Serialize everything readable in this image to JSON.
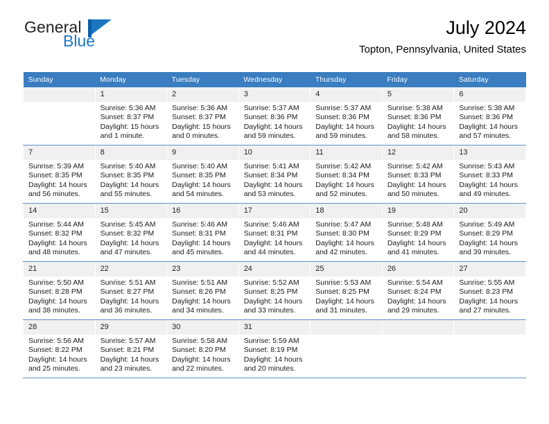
{
  "brand": {
    "word_general": "General",
    "word_blue": "Blue",
    "flag_color": "#1c77c3",
    "flag_bar_color": "#0b5ea8"
  },
  "header": {
    "title": "July 2024",
    "subtitle": "Topton, Pennsylvania, United States",
    "accent_color": "#3a7dc0"
  },
  "calendar": {
    "weekday_headers": [
      "Sunday",
      "Monday",
      "Tuesday",
      "Wednesday",
      "Thursday",
      "Friday",
      "Saturday"
    ],
    "weeks": [
      [
        {
          "day": "",
          "lines": []
        },
        {
          "day": "1",
          "lines": [
            "Sunrise: 5:36 AM",
            "Sunset: 8:37 PM",
            "Daylight: 15 hours",
            "and 1 minute."
          ]
        },
        {
          "day": "2",
          "lines": [
            "Sunrise: 5:36 AM",
            "Sunset: 8:37 PM",
            "Daylight: 15 hours",
            "and 0 minutes."
          ]
        },
        {
          "day": "3",
          "lines": [
            "Sunrise: 5:37 AM",
            "Sunset: 8:36 PM",
            "Daylight: 14 hours",
            "and 59 minutes."
          ]
        },
        {
          "day": "4",
          "lines": [
            "Sunrise: 5:37 AM",
            "Sunset: 8:36 PM",
            "Daylight: 14 hours",
            "and 59 minutes."
          ]
        },
        {
          "day": "5",
          "lines": [
            "Sunrise: 5:38 AM",
            "Sunset: 8:36 PM",
            "Daylight: 14 hours",
            "and 58 minutes."
          ]
        },
        {
          "day": "6",
          "lines": [
            "Sunrise: 5:38 AM",
            "Sunset: 8:36 PM",
            "Daylight: 14 hours",
            "and 57 minutes."
          ]
        }
      ],
      [
        {
          "day": "7",
          "lines": [
            "Sunrise: 5:39 AM",
            "Sunset: 8:35 PM",
            "Daylight: 14 hours",
            "and 56 minutes."
          ]
        },
        {
          "day": "8",
          "lines": [
            "Sunrise: 5:40 AM",
            "Sunset: 8:35 PM",
            "Daylight: 14 hours",
            "and 55 minutes."
          ]
        },
        {
          "day": "9",
          "lines": [
            "Sunrise: 5:40 AM",
            "Sunset: 8:35 PM",
            "Daylight: 14 hours",
            "and 54 minutes."
          ]
        },
        {
          "day": "10",
          "lines": [
            "Sunrise: 5:41 AM",
            "Sunset: 8:34 PM",
            "Daylight: 14 hours",
            "and 53 minutes."
          ]
        },
        {
          "day": "11",
          "lines": [
            "Sunrise: 5:42 AM",
            "Sunset: 8:34 PM",
            "Daylight: 14 hours",
            "and 52 minutes."
          ]
        },
        {
          "day": "12",
          "lines": [
            "Sunrise: 5:42 AM",
            "Sunset: 8:33 PM",
            "Daylight: 14 hours",
            "and 50 minutes."
          ]
        },
        {
          "day": "13",
          "lines": [
            "Sunrise: 5:43 AM",
            "Sunset: 8:33 PM",
            "Daylight: 14 hours",
            "and 49 minutes."
          ]
        }
      ],
      [
        {
          "day": "14",
          "lines": [
            "Sunrise: 5:44 AM",
            "Sunset: 8:32 PM",
            "Daylight: 14 hours",
            "and 48 minutes."
          ]
        },
        {
          "day": "15",
          "lines": [
            "Sunrise: 5:45 AM",
            "Sunset: 8:32 PM",
            "Daylight: 14 hours",
            "and 47 minutes."
          ]
        },
        {
          "day": "16",
          "lines": [
            "Sunrise: 5:46 AM",
            "Sunset: 8:31 PM",
            "Daylight: 14 hours",
            "and 45 minutes."
          ]
        },
        {
          "day": "17",
          "lines": [
            "Sunrise: 5:46 AM",
            "Sunset: 8:31 PM",
            "Daylight: 14 hours",
            "and 44 minutes."
          ]
        },
        {
          "day": "18",
          "lines": [
            "Sunrise: 5:47 AM",
            "Sunset: 8:30 PM",
            "Daylight: 14 hours",
            "and 42 minutes."
          ]
        },
        {
          "day": "19",
          "lines": [
            "Sunrise: 5:48 AM",
            "Sunset: 8:29 PM",
            "Daylight: 14 hours",
            "and 41 minutes."
          ]
        },
        {
          "day": "20",
          "lines": [
            "Sunrise: 5:49 AM",
            "Sunset: 8:29 PM",
            "Daylight: 14 hours",
            "and 39 minutes."
          ]
        }
      ],
      [
        {
          "day": "21",
          "lines": [
            "Sunrise: 5:50 AM",
            "Sunset: 8:28 PM",
            "Daylight: 14 hours",
            "and 38 minutes."
          ]
        },
        {
          "day": "22",
          "lines": [
            "Sunrise: 5:51 AM",
            "Sunset: 8:27 PM",
            "Daylight: 14 hours",
            "and 36 minutes."
          ]
        },
        {
          "day": "23",
          "lines": [
            "Sunrise: 5:51 AM",
            "Sunset: 8:26 PM",
            "Daylight: 14 hours",
            "and 34 minutes."
          ]
        },
        {
          "day": "24",
          "lines": [
            "Sunrise: 5:52 AM",
            "Sunset: 8:25 PM",
            "Daylight: 14 hours",
            "and 33 minutes."
          ]
        },
        {
          "day": "25",
          "lines": [
            "Sunrise: 5:53 AM",
            "Sunset: 8:25 PM",
            "Daylight: 14 hours",
            "and 31 minutes."
          ]
        },
        {
          "day": "26",
          "lines": [
            "Sunrise: 5:54 AM",
            "Sunset: 8:24 PM",
            "Daylight: 14 hours",
            "and 29 minutes."
          ]
        },
        {
          "day": "27",
          "lines": [
            "Sunrise: 5:55 AM",
            "Sunset: 8:23 PM",
            "Daylight: 14 hours",
            "and 27 minutes."
          ]
        }
      ],
      [
        {
          "day": "28",
          "lines": [
            "Sunrise: 5:56 AM",
            "Sunset: 8:22 PM",
            "Daylight: 14 hours",
            "and 25 minutes."
          ]
        },
        {
          "day": "29",
          "lines": [
            "Sunrise: 5:57 AM",
            "Sunset: 8:21 PM",
            "Daylight: 14 hours",
            "and 23 minutes."
          ]
        },
        {
          "day": "30",
          "lines": [
            "Sunrise: 5:58 AM",
            "Sunset: 8:20 PM",
            "Daylight: 14 hours",
            "and 22 minutes."
          ]
        },
        {
          "day": "31",
          "lines": [
            "Sunrise: 5:59 AM",
            "Sunset: 8:19 PM",
            "Daylight: 14 hours",
            "and 20 minutes."
          ]
        },
        {
          "day": "",
          "lines": []
        },
        {
          "day": "",
          "lines": []
        },
        {
          "day": "",
          "lines": []
        }
      ]
    ]
  }
}
